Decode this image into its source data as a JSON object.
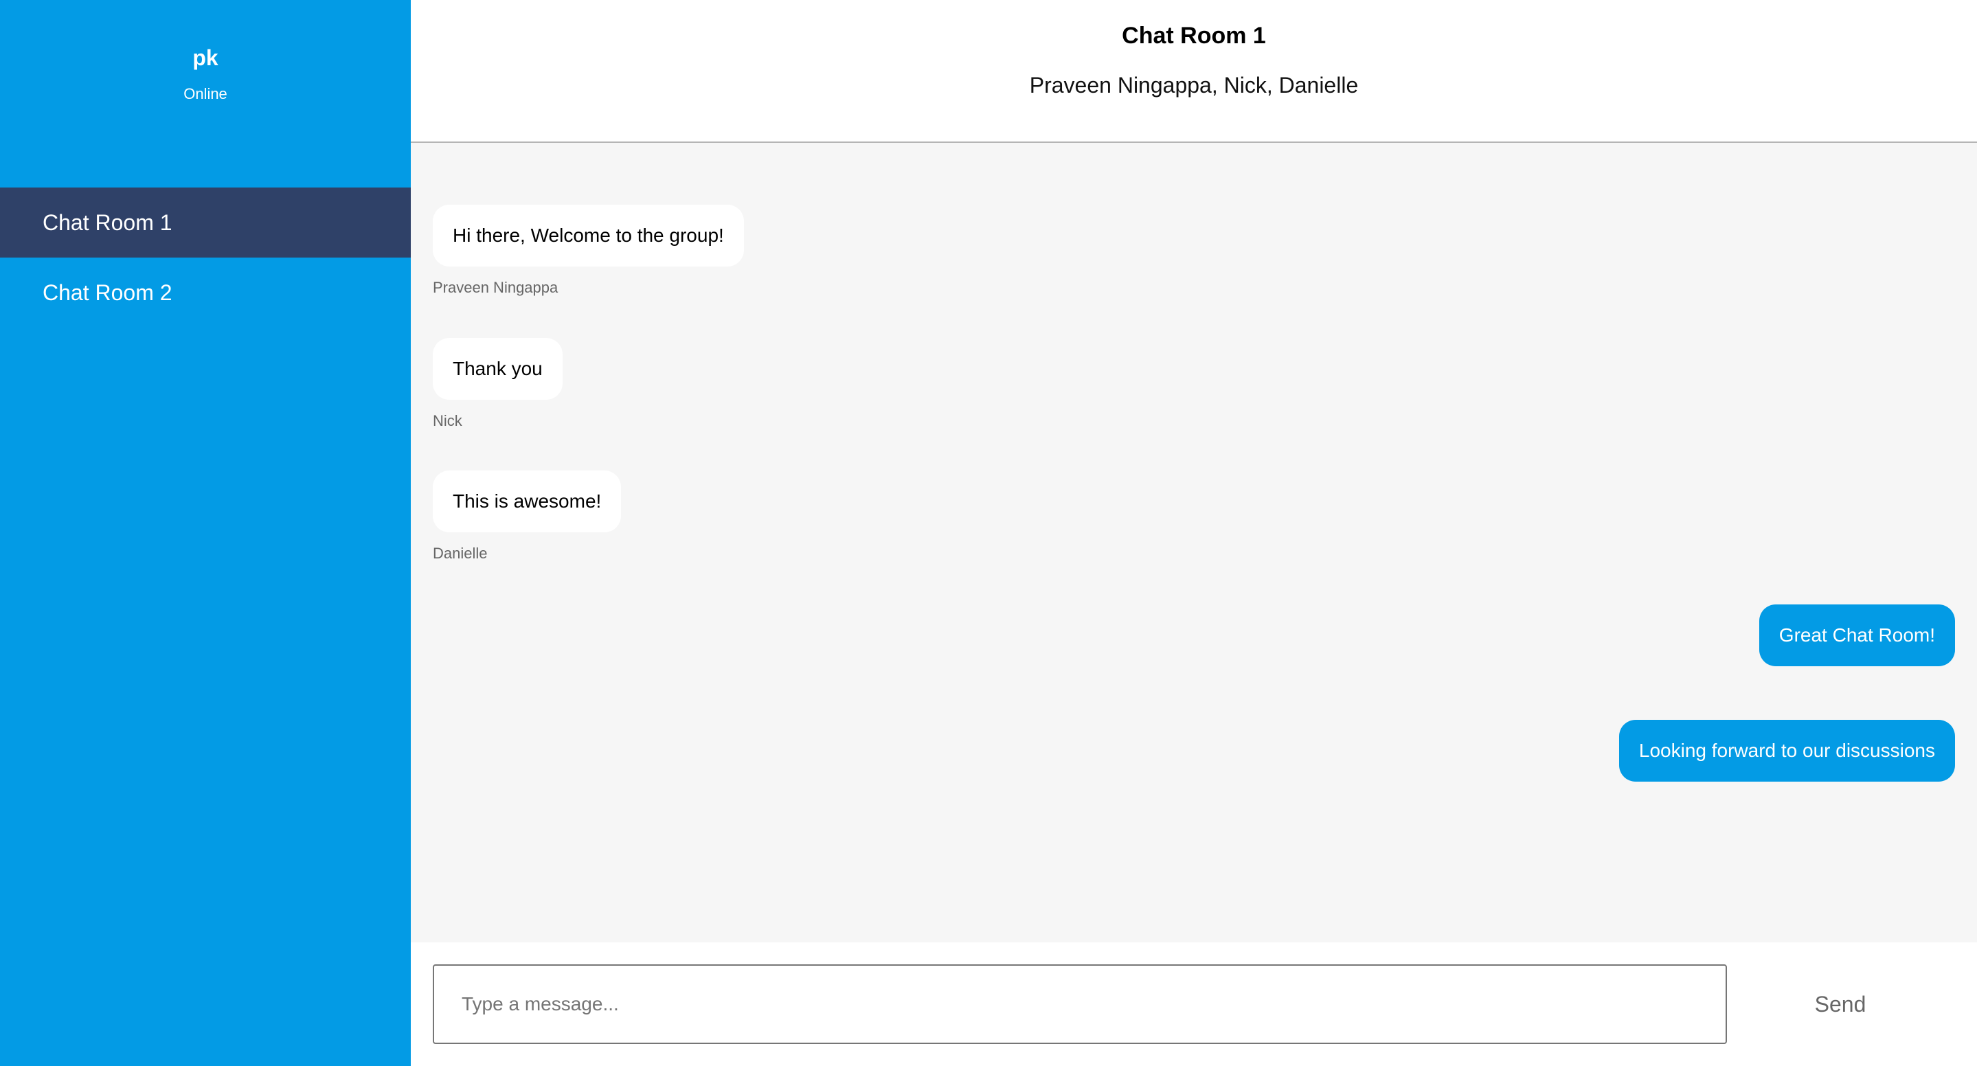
{
  "user": {
    "name": "pk",
    "status": "Online"
  },
  "rooms": [
    {
      "label": "Chat Room 1",
      "active": true
    },
    {
      "label": "Chat Room 2",
      "active": false
    }
  ],
  "header": {
    "title": "Chat Room 1",
    "members": "Praveen Ningappa, Nick, Danielle"
  },
  "messages": [
    {
      "text": "Hi there, Welcome to the group!",
      "sender": "Praveen Ningappa",
      "own": false
    },
    {
      "text": "Thank you",
      "sender": "Nick",
      "own": false
    },
    {
      "text": "This is awesome!",
      "sender": "Danielle",
      "own": false
    },
    {
      "text": "Great Chat Room!",
      "own": true
    },
    {
      "text": "Looking forward to our discussions",
      "own": true
    }
  ],
  "composer": {
    "placeholder": "Type a message...",
    "send_label": "Send"
  },
  "colors": {
    "accent": "#039be5",
    "active_room": "#2f4168",
    "chat_background": "#f6f6f6"
  }
}
